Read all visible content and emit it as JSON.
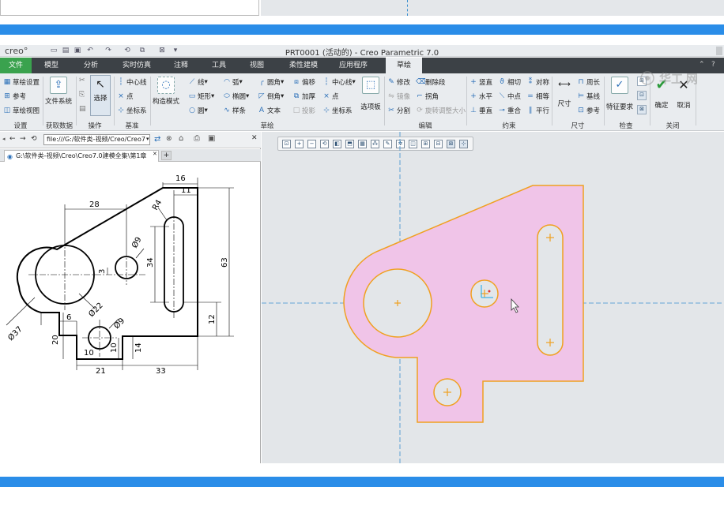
{
  "app": {
    "logo": "creo°",
    "window_title": "PRT0001 (活动的) - Creo Parametric 7.0"
  },
  "menu_tabs": [
    "文件",
    "模型",
    "分析",
    "实时仿真",
    "注释",
    "工具",
    "视图",
    "柔性建模",
    "应用程序",
    "草绘"
  ],
  "ribbon": {
    "setup": {
      "items": [
        "草绘设置",
        "参考",
        "草绘视图"
      ],
      "label": "设置"
    },
    "get_data": {
      "file_system": "文件系统",
      "label": "获取数据"
    },
    "operations": {
      "select": "选择",
      "label": "操作"
    },
    "datum": {
      "items": [
        "中心线",
        "点",
        "坐标系"
      ],
      "label": "基准"
    },
    "sketch": {
      "construction": "构造模式",
      "col1": [
        "线",
        "矩形",
        "圆"
      ],
      "col2": [
        "弧",
        "椭圆",
        "样条"
      ],
      "col3": [
        "圆角",
        "倒角",
        "文本"
      ],
      "col4": [
        "偏移",
        "加厚",
        "投影"
      ],
      "col5": [
        "中心线",
        "点",
        "坐标系"
      ],
      "palette": "选项板",
      "label": "草绘"
    },
    "editing": {
      "col1": [
        "修改",
        "镜像",
        "分割"
      ],
      "col2": [
        "删除段",
        "拐角",
        "旋转调整大小"
      ],
      "label": "编辑"
    },
    "constrain": {
      "col1": [
        "竖直",
        "水平",
        "垂直"
      ],
      "col2": [
        "相切",
        "中点",
        "重合"
      ],
      "col3": [
        "对称",
        "相等",
        "平行"
      ],
      "label": "约束"
    },
    "dimension": {
      "size": "尺寸",
      "items": [
        "周长",
        "基线",
        "参考"
      ],
      "label": "尺寸"
    },
    "inspect": {
      "feature_req": "特征要求",
      "label": "检查"
    },
    "close": {
      "ok": "确定",
      "cancel": "取消",
      "label": "关闭"
    }
  },
  "browser": {
    "url": "file:///G:/软件类-视频/Creo/Creo7",
    "tab_title": "G:\\软件类-视频\\Creo\\Creo7.0建模全集\\第1章"
  },
  "drawing": {
    "dims": [
      "16",
      "11",
      "28",
      "R4",
      "Ø9",
      "34",
      "63",
      "3",
      "Ø37",
      "Ø22",
      "12",
      "6",
      "Ø9",
      "20",
      "10",
      "10",
      "14",
      "21",
      "33"
    ]
  },
  "colors": {
    "blue_bar": "#2a8de8",
    "file_tab": "#3aa24e",
    "sketch_fill": "#f0c4e8",
    "sketch_stroke": "#f0a020",
    "axis_dash": "#3a8fcf"
  },
  "watermark": {
    "text": "华工"
  }
}
